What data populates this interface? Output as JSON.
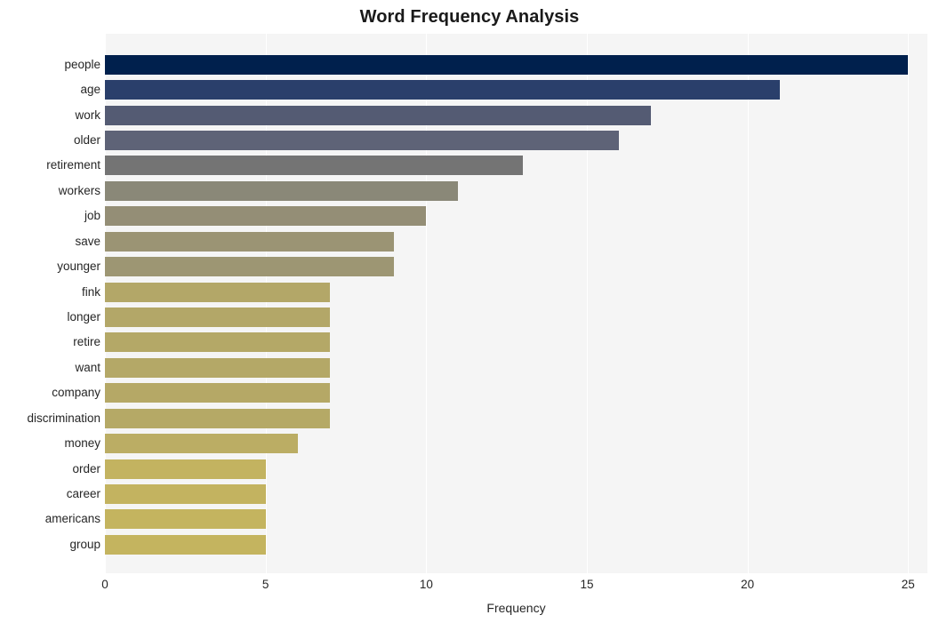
{
  "chart_data": {
    "type": "bar",
    "orientation": "horizontal",
    "title": "Word Frequency Analysis",
    "xlabel": "Frequency",
    "ylabel": "",
    "xlim": [
      0,
      25.6
    ],
    "xticks": [
      0,
      5,
      10,
      15,
      20,
      25
    ],
    "xtick_labels": [
      "0",
      "5",
      "10",
      "15",
      "20",
      "25"
    ],
    "grid": true,
    "grid_axis": "x",
    "legend": "none",
    "plot_background": "#f5f5f5",
    "categories": [
      "people",
      "age",
      "work",
      "older",
      "retirement",
      "workers",
      "job",
      "save",
      "younger",
      "fink",
      "longer",
      "retire",
      "want",
      "company",
      "discrimination",
      "money",
      "order",
      "career",
      "americans",
      "group"
    ],
    "values": [
      25,
      21,
      17,
      16,
      13,
      11,
      10,
      9,
      9,
      7,
      7,
      7,
      7,
      7,
      7,
      6,
      5,
      5,
      5,
      5
    ],
    "bar_colors": [
      "#00204d",
      "#2a3f6b",
      "#545b73",
      "#5e6377",
      "#747474",
      "#8a8878",
      "#948e76",
      "#9b9474",
      "#9d9673",
      "#b3a768",
      "#b3a768",
      "#b4a867",
      "#b4a867",
      "#b5a866",
      "#b5a966",
      "#bbad64",
      "#c3b360",
      "#c3b360",
      "#c4b45f",
      "#c4b45f"
    ]
  }
}
